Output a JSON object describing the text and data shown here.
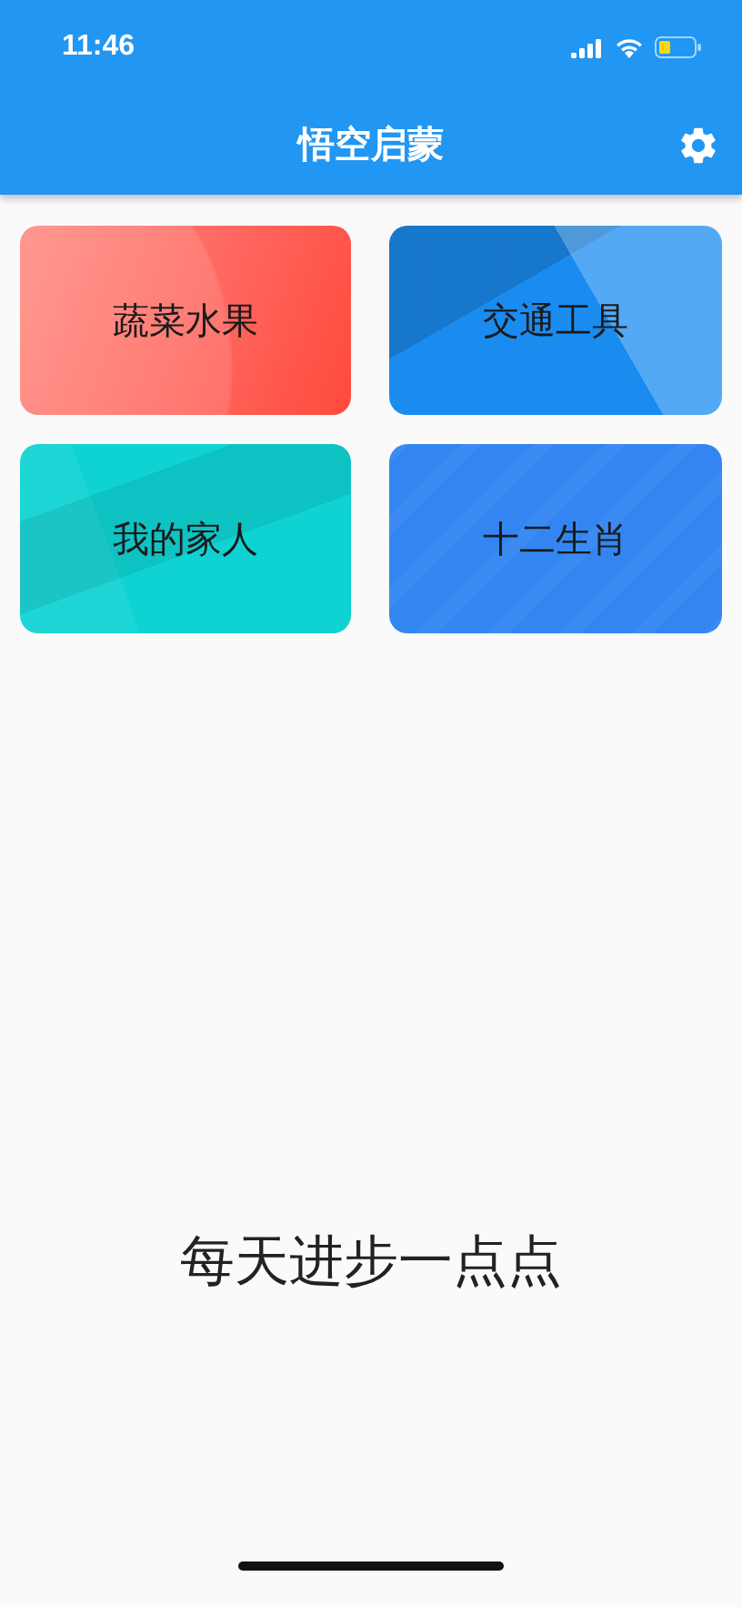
{
  "status_bar": {
    "time": "11:46"
  },
  "app_bar": {
    "title": "悟空启蒙"
  },
  "cards": [
    {
      "label": "蔬菜水果",
      "kind": "wave",
      "color": "#ff6b63"
    },
    {
      "label": "交通工具",
      "kind": "facets",
      "color": "#1a8cf0"
    },
    {
      "label": "我的家人",
      "kind": "shards",
      "color": "#0fd3d3"
    },
    {
      "label": "十二生肖",
      "kind": "pattern",
      "color": "#3386f2"
    }
  ],
  "motto": "每天进步一点点"
}
